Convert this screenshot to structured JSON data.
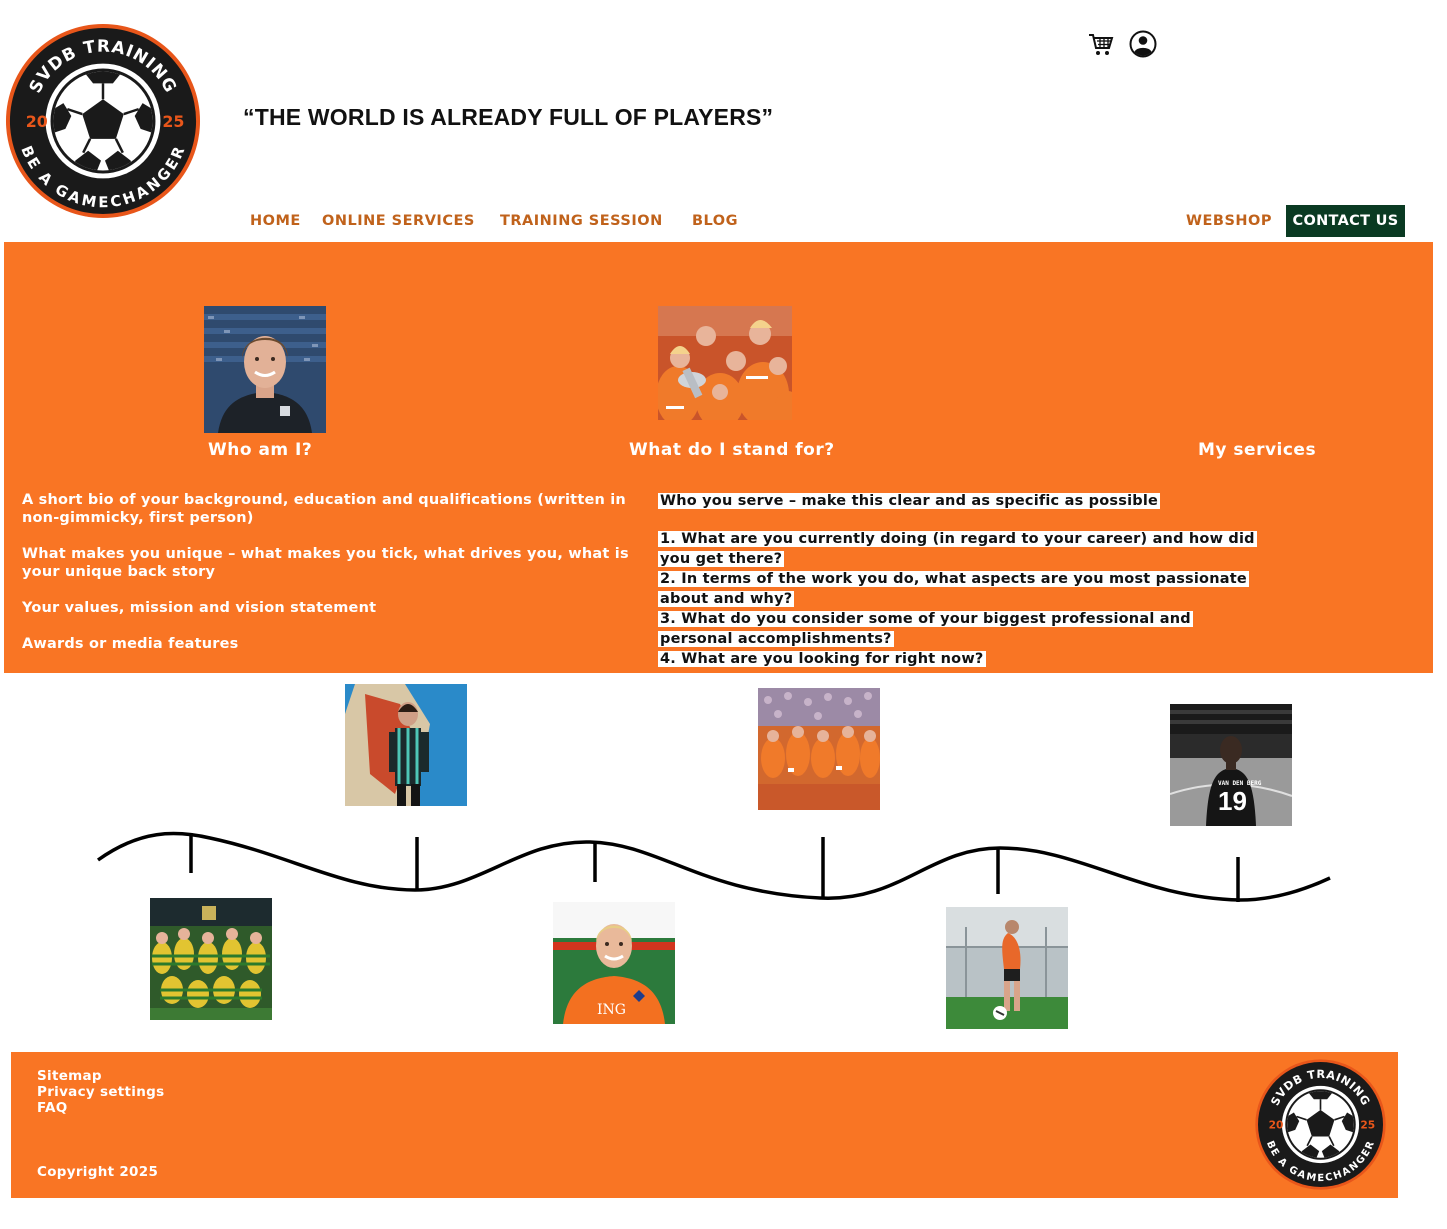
{
  "brand": {
    "logo_ring_text_top": "SVDB TRAINING",
    "logo_ring_text_bottom": "BE A GAMECHANGER",
    "logo_year_left": "20",
    "logo_year_right": "25",
    "tagline": "“THE WORLD IS ALREADY FULL OF PLAYERS”"
  },
  "header_icons": [
    "cart-icon",
    "account-icon"
  ],
  "nav": {
    "home": "HOME",
    "online_services": "ONLINE SERVICES",
    "training_session": "TRAINING SESSION",
    "blog": "BLOG",
    "webshop": "WEBSHOP",
    "contact": "CONTACT US"
  },
  "about": {
    "columns": {
      "who": "Who am I?",
      "stand": "What do I stand for?",
      "services": "My services"
    },
    "bio_items": [
      "A short bio of your background, education and qualifications (written in non-gimmicky, first person)",
      "What makes you unique – what makes you tick, what drives you, what is your unique back story",
      "Your values, mission and vision statement",
      "Awards or media features"
    ],
    "serve_heading": "Who you serve – make this clear and as specific as possible",
    "questions": [
      "1. What are you currently doing (in regard to your career) and how did you get there?",
      "2. In terms of the work you do, what aspects are you most passionate about and why?",
      "3. What do you consider some of your biggest professional and personal accomplishments?",
      "4. What are you looking for right now?"
    ]
  },
  "footer": {
    "links": [
      "Sitemap",
      "Privacy settings",
      "FAQ"
    ],
    "copyright": "Copyright 2025"
  },
  "colors": {
    "orange": "#f97524",
    "nav_text": "#c0621b",
    "contact_bg": "#0a3a22",
    "logo_ring": "#1a1a1a",
    "logo_accent": "#e8561a"
  }
}
